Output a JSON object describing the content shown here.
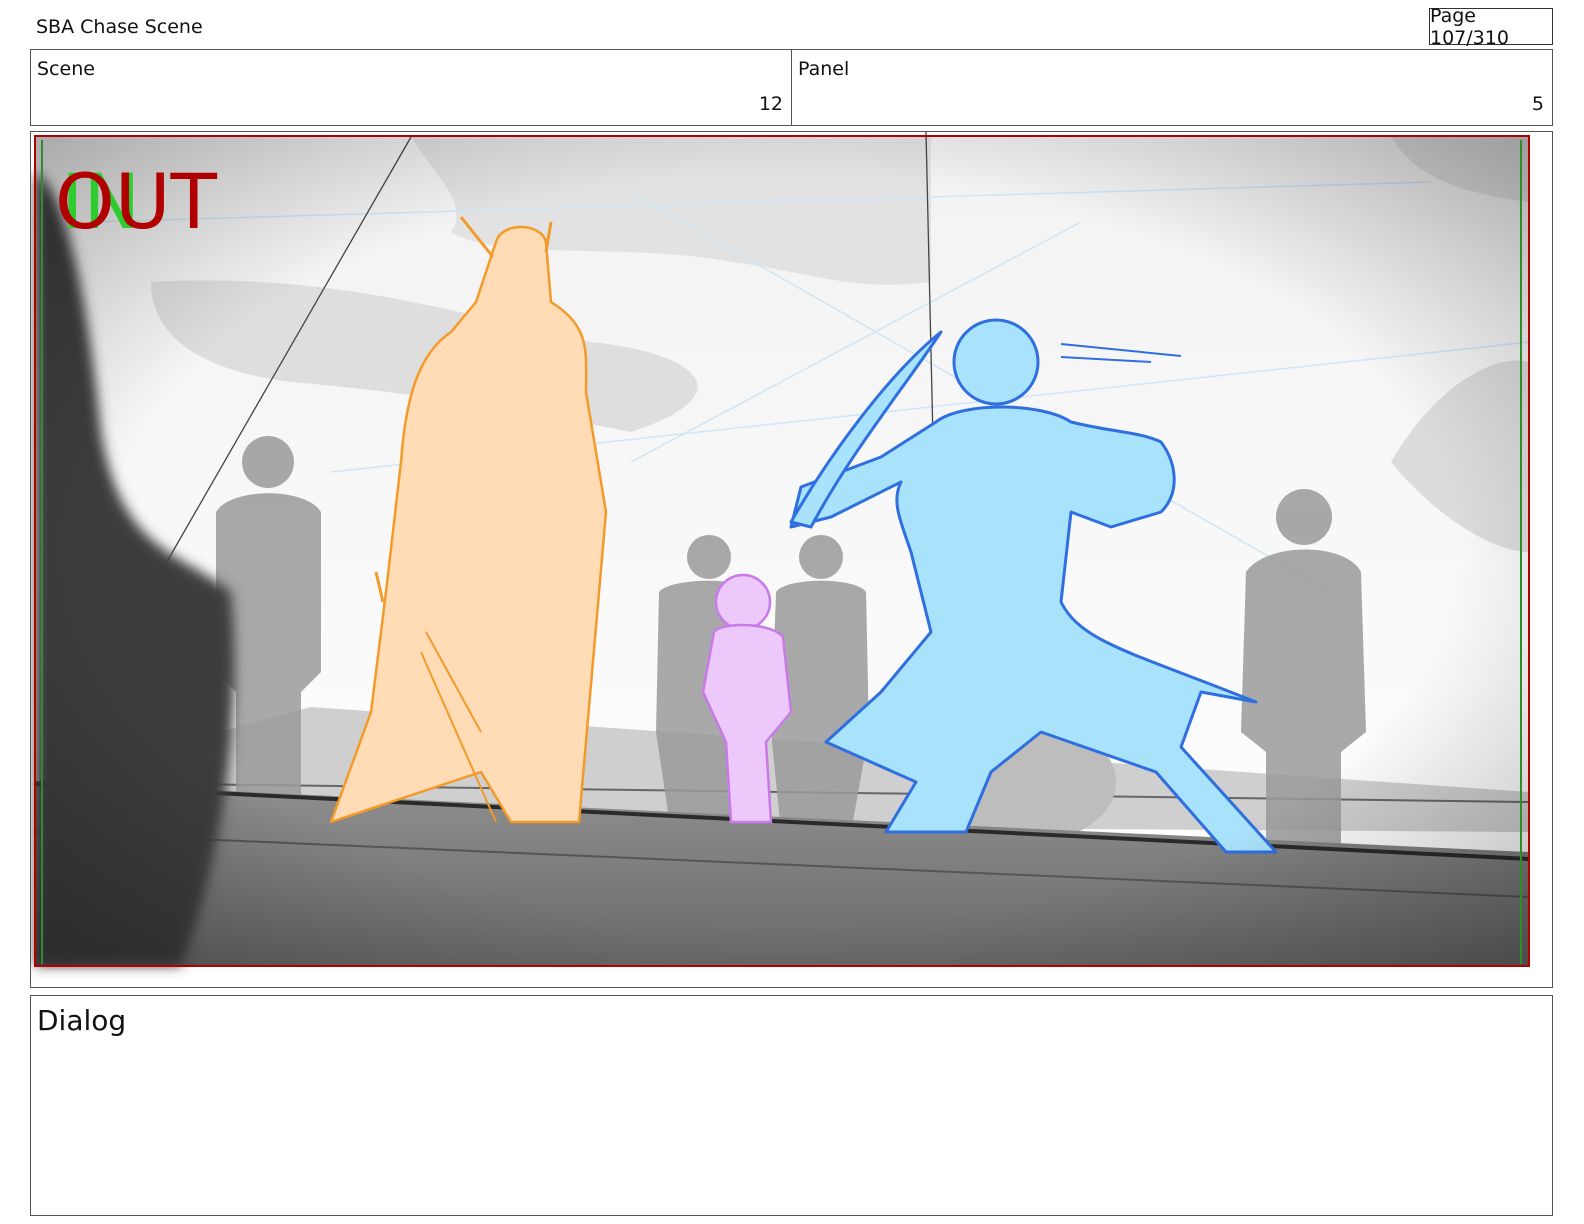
{
  "header": {
    "doc_title": "SBA Chase Scene",
    "page_label": "Page 107/310"
  },
  "meta": {
    "scene_label": "Scene",
    "scene_value": "12",
    "panel_label": "Panel",
    "panel_value": "5"
  },
  "panel": {
    "marker_in": "IN",
    "marker_out": "OUT",
    "colors": {
      "orange_figure": "#f39a2a",
      "blue_figure": "#3a9ef0",
      "purple_figure": "#c77ae8",
      "grey_figure": "#9a9a9a",
      "frame_red": "#b00000",
      "frame_green": "#2e8b2e"
    }
  },
  "dialog": {
    "label": "Dialog"
  }
}
